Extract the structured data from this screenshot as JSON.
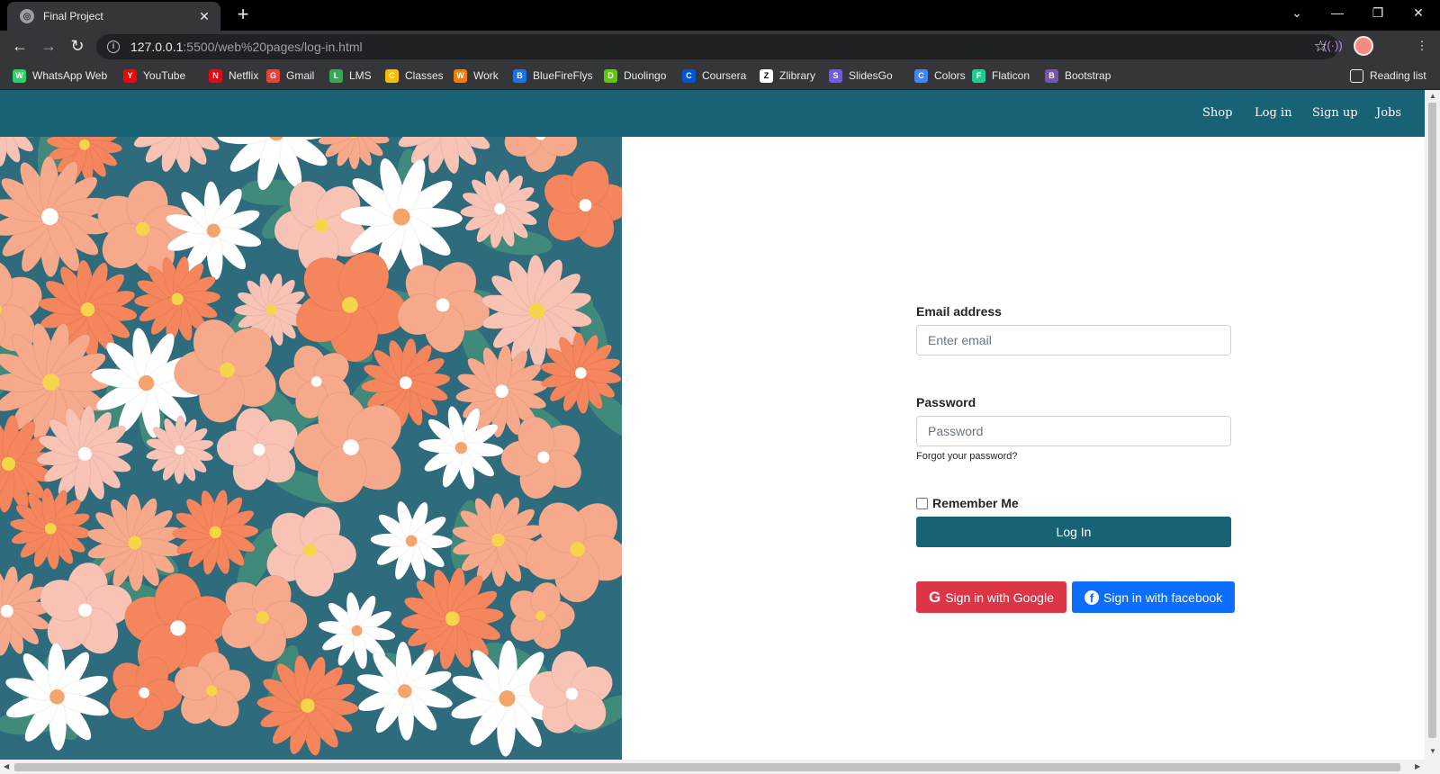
{
  "browser": {
    "tab_title": "Final Project",
    "url_host": "127.0.0.1",
    "url_path": ":5500/web%20pages/log-in.html",
    "reading_list_label": "Reading list",
    "bookmarks": [
      {
        "label": "WhatsApp Web",
        "icon": "whatsapp-icon",
        "color": "#25d366"
      },
      {
        "label": "YouTube",
        "icon": "youtube-icon",
        "color": "#ff0000"
      },
      {
        "label": "Netflix",
        "icon": "netflix-icon",
        "color": "#e50914"
      },
      {
        "label": "Gmail",
        "icon": "gmail-icon",
        "color": "#ea4335"
      },
      {
        "label": "LMS",
        "icon": "lms-icon",
        "color": "#34a853"
      },
      {
        "label": "Classes",
        "icon": "classes-icon",
        "color": "#fbbc04"
      },
      {
        "label": "Work",
        "icon": "work-icon",
        "color": "#f57c00"
      },
      {
        "label": "BlueFireFlys",
        "icon": "bluefireflys-icon",
        "color": "#1a73e8"
      },
      {
        "label": "Duolingo",
        "icon": "duolingo-icon",
        "color": "#58cc02"
      },
      {
        "label": "Coursera",
        "icon": "coursera-icon",
        "color": "#0056d2"
      },
      {
        "label": "Zlibrary",
        "icon": "zlibrary-icon",
        "color": "#ffffff"
      },
      {
        "label": "SlidesGo",
        "icon": "slidesgo-icon",
        "color": "#6c5ce7"
      },
      {
        "label": "Colors",
        "icon": "colors-icon",
        "color": "#4285f4"
      },
      {
        "label": "Flaticon",
        "icon": "flaticon-icon",
        "color": "#1fcc8f"
      },
      {
        "label": "Bootstrap",
        "icon": "bootstrap-icon",
        "color": "#7952b3"
      }
    ]
  },
  "navbar": {
    "background": "#176275",
    "links": [
      "Shop",
      "Log in",
      "Sign up",
      "Jobs"
    ]
  },
  "form": {
    "email_label": "Email address",
    "email_placeholder": "Enter email",
    "password_label": "Password",
    "password_placeholder": "Password",
    "forgot_text": "Forgot your password?",
    "remember_label": "Remember Me",
    "remember_checked": false,
    "login_button": "Log In",
    "google_button": "Sign in with Google",
    "facebook_button": "Sign in with facebook",
    "colors": {
      "login": "#176275",
      "google": "#dc3545",
      "facebook": "#0d6efd"
    }
  }
}
